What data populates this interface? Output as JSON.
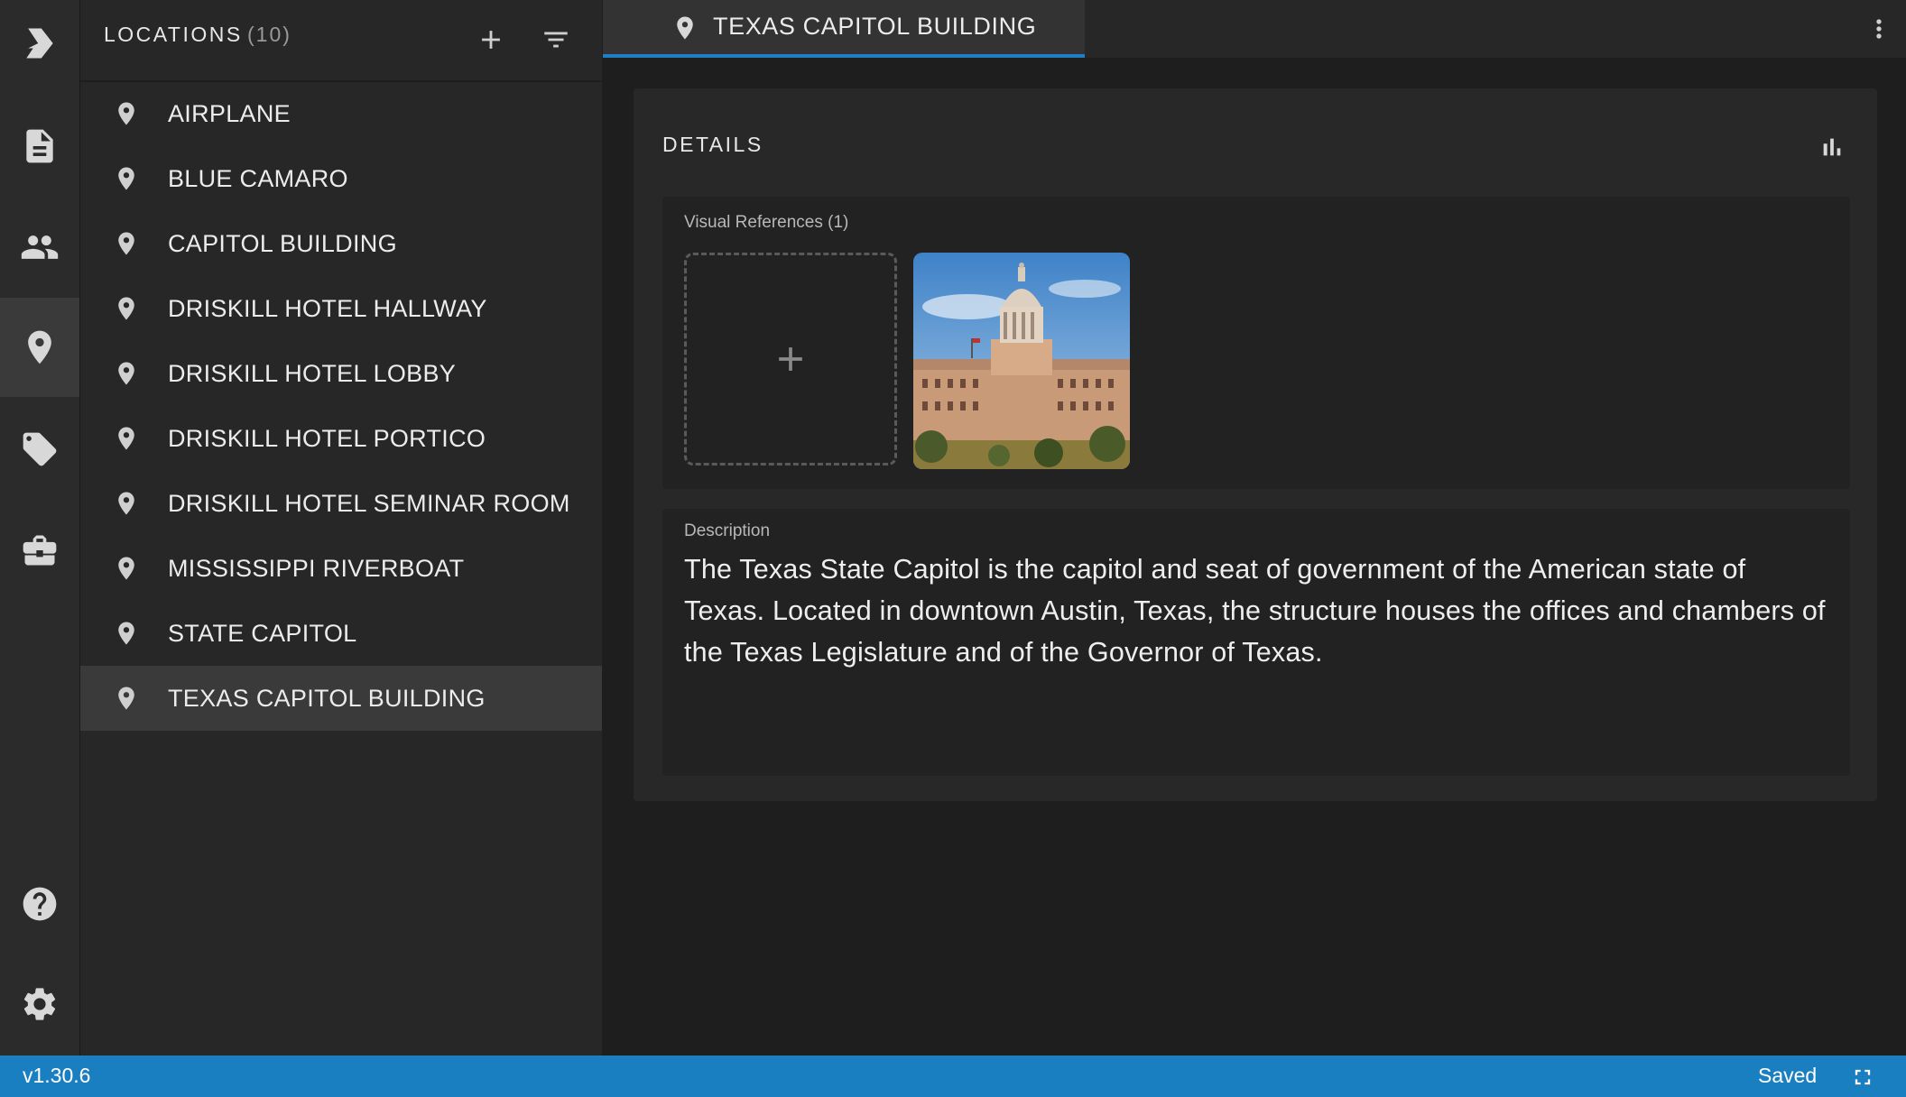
{
  "rail": {
    "items": [
      {
        "icon": "app-logo-icon"
      },
      {
        "icon": "document-icon"
      },
      {
        "icon": "people-icon"
      },
      {
        "icon": "location-pin-icon",
        "active": true
      },
      {
        "icon": "tag-icon"
      },
      {
        "icon": "briefcase-icon"
      },
      {
        "icon": "help-icon"
      },
      {
        "icon": "gear-icon"
      }
    ]
  },
  "locations": {
    "title": "LOCATIONS",
    "count": "(10)",
    "add_icon": "plus-icon",
    "filter_icon": "filter-icon",
    "items": [
      {
        "label": "AIRPLANE"
      },
      {
        "label": "BLUE CAMARO"
      },
      {
        "label": "CAPITOL BUILDING"
      },
      {
        "label": "DRISKILL HOTEL HALLWAY"
      },
      {
        "label": "DRISKILL HOTEL LOBBY"
      },
      {
        "label": "DRISKILL HOTEL PORTICO"
      },
      {
        "label": "DRISKILL HOTEL SEMINAR ROOM"
      },
      {
        "label": "MISSISSIPPI RIVERBOAT"
      },
      {
        "label": "STATE CAPITOL"
      },
      {
        "label": "TEXAS CAPITOL BUILDING",
        "selected": true
      }
    ]
  },
  "tab": {
    "label": "TEXAS CAPITOL BUILDING",
    "icon": "location-pin-icon"
  },
  "details": {
    "title": "DETAILS",
    "visual_refs_label": "Visual References (1)",
    "description_label": "Description",
    "description": "The Texas State Capitol is the capitol and seat of government of the American state of Texas. Located in downtown Austin, Texas, the structure houses the offices and chambers of the Texas Legislature and of the Governor of Texas."
  },
  "status": {
    "version": "v1.30.6",
    "saved": "Saved"
  },
  "colors": {
    "accent": "#1a7fc1",
    "background": "#1e1e1e",
    "panel": "#272727"
  }
}
